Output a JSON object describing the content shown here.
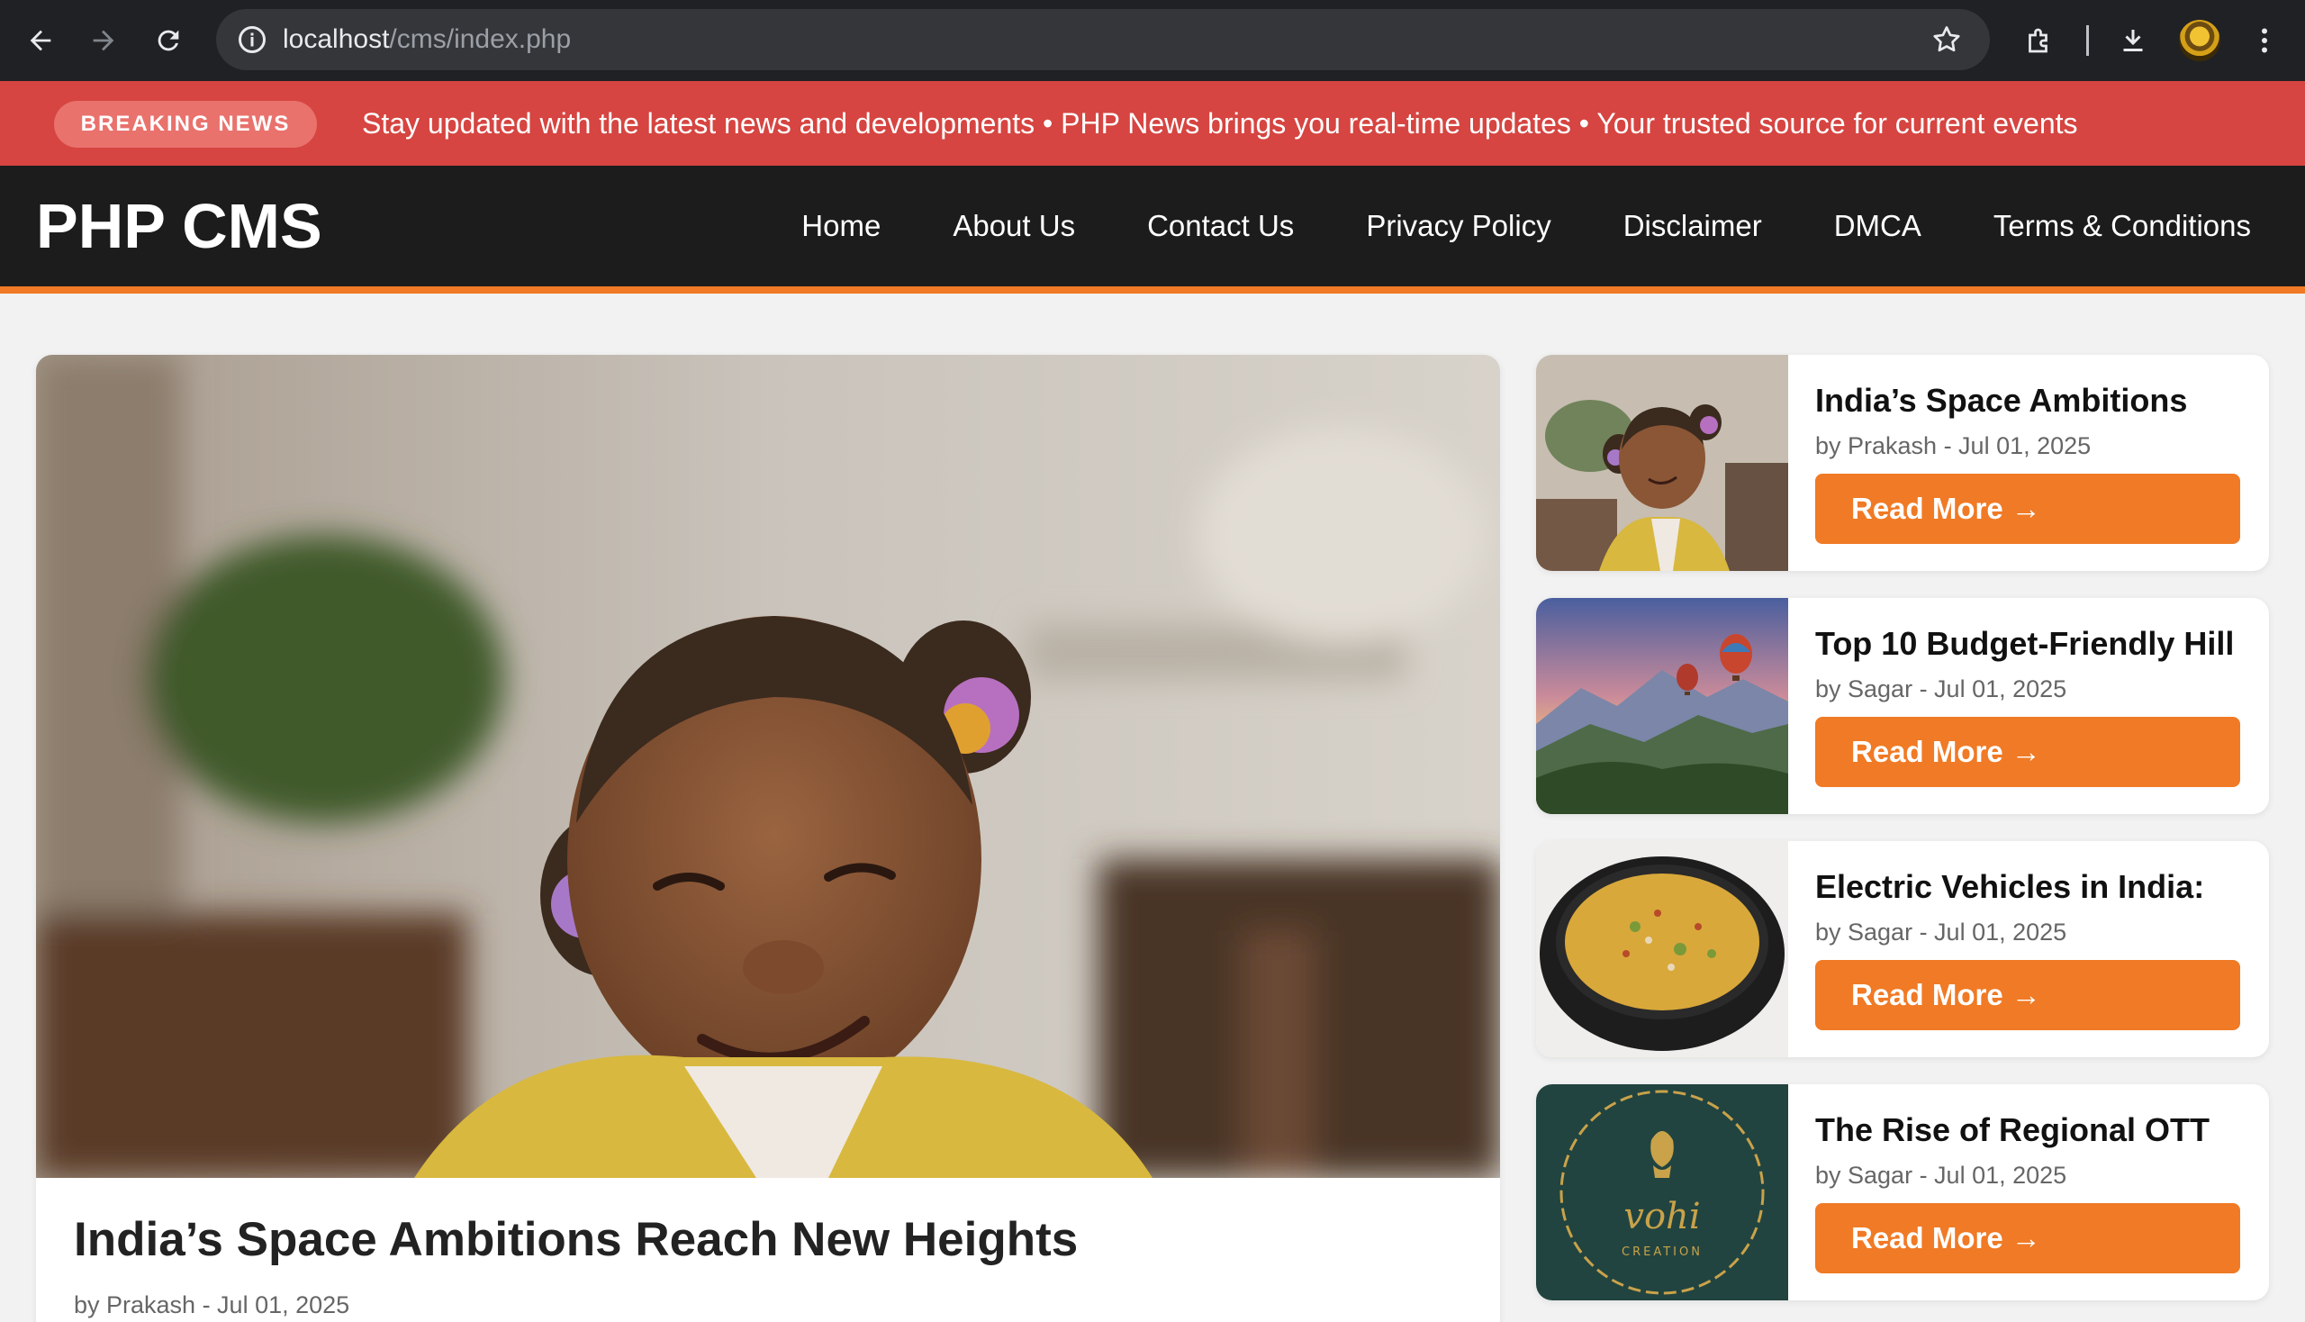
{
  "browser": {
    "url_host": "localhost",
    "url_path": "/cms/index.php"
  },
  "breaking": {
    "badge": "BREAKING NEWS",
    "ticker": "Stay updated with the latest news and developments • PHP News brings you real-time updates • Your trusted source for current events"
  },
  "site": {
    "logo": "PHP CMS",
    "nav": [
      "Home",
      "About Us",
      "Contact Us",
      "Privacy Policy",
      "Disclaimer",
      "DMCA",
      "Terms & Conditions"
    ]
  },
  "featured": {
    "title": "India’s Space Ambitions Reach New Heights",
    "meta": "by Prakash - Jul 01, 2025"
  },
  "sidebar": [
    {
      "title": "India’s Space Ambitions",
      "meta": "by Prakash - Jul 01, 2025",
      "button": "Read More →",
      "image": "smiling-girl"
    },
    {
      "title": "Top 10 Budget-Friendly Hill",
      "meta": "by Sagar - Jul 01, 2025",
      "button": "Read More →",
      "image": "hot-air-balloons-mountains"
    },
    {
      "title": "Electric Vehicles in India:",
      "meta": "by Sagar - Jul 01, 2025",
      "button": "Read More →",
      "image": "food-bowl"
    },
    {
      "title": "The Rise of Regional OTT",
      "meta": "by Sagar - Jul 01, 2025",
      "button": "Read More →",
      "image": "vohi-creation-logo"
    }
  ],
  "logo_text": {
    "vohi": "vohi",
    "creation": "CREATION"
  },
  "colors": {
    "accent": "#f07a25",
    "breaking_bg": "#d64541",
    "header_bg": "#1c1c1c"
  }
}
